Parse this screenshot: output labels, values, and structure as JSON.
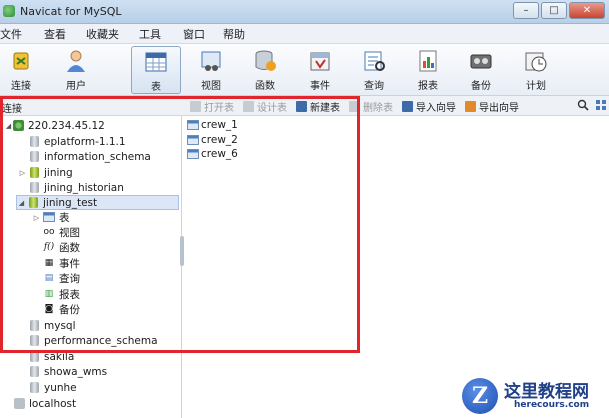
{
  "window": {
    "title": "Navicat for MySQL",
    "buttons": {
      "minimize": "–",
      "maximize": "□",
      "close": "✕"
    }
  },
  "menu": [
    "文件",
    "查看",
    "收藏夹",
    "工具",
    "窗口",
    "帮助"
  ],
  "toolbar": {
    "items": [
      {
        "label": "连接",
        "icon": "connection-icon"
      },
      {
        "label": "用户",
        "icon": "user-icon"
      },
      {
        "label": "表",
        "icon": "table-icon",
        "active": true
      },
      {
        "label": "视图",
        "icon": "view-icon"
      },
      {
        "label": "函数",
        "icon": "function-icon"
      },
      {
        "label": "事件",
        "icon": "event-icon"
      },
      {
        "label": "查询",
        "icon": "query-icon"
      },
      {
        "label": "报表",
        "icon": "report-icon"
      },
      {
        "label": "备份",
        "icon": "backup-icon"
      },
      {
        "label": "计划",
        "icon": "schedule-icon"
      }
    ]
  },
  "subbar": {
    "connections_label": "连接",
    "actions": [
      {
        "label": "打开表",
        "enabled": false
      },
      {
        "label": "设计表",
        "enabled": false
      },
      {
        "label": "新建表",
        "enabled": true
      },
      {
        "label": "删除表",
        "enabled": false
      },
      {
        "label": "导入向导",
        "enabled": true
      },
      {
        "label": "导出向导",
        "enabled": true
      }
    ]
  },
  "tree": {
    "server": "220.234.45.12",
    "databases": [
      "eplatform-1.1.1",
      "information_schema",
      "jining",
      "jining_historian",
      "jining_test",
      "mysql",
      "performance_schema",
      "sakila",
      "showa_wms",
      "yunhe"
    ],
    "objects": [
      "表",
      "视图",
      "函数",
      "事件",
      "查询",
      "报表",
      "备份"
    ],
    "localhost": "localhost"
  },
  "tables": [
    "crew_1",
    "crew_2",
    "crew_6"
  ],
  "watermark": {
    "logo_letter": "Z",
    "title": "这里教程网",
    "url": "herecours.com"
  },
  "colors": {
    "highlight": "#e0252c",
    "selection": "#dbe7f7",
    "toolbar_active": "#d6e3f2"
  }
}
